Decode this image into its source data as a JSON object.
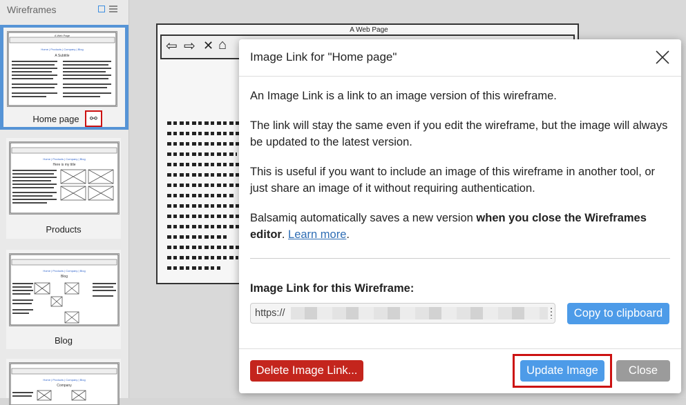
{
  "sidebar": {
    "title": "Wireframes",
    "items": [
      {
        "label": "Home page",
        "selected": true
      },
      {
        "label": "Products",
        "selected": false
      },
      {
        "label": "Blog",
        "selected": false
      },
      {
        "label": "",
        "selected": false
      }
    ],
    "thumbs": [
      {
        "subtitle": "A Subtitle"
      },
      {
        "subtitle": "Here is my title"
      },
      {
        "subtitle": "Blog"
      },
      {
        "subtitle": "Company"
      }
    ],
    "thumb_nav": "Home | Products | Company | Blog",
    "thumb_header": "A Web Page"
  },
  "canvas": {
    "wireframe_title": "A Web Page"
  },
  "dialog": {
    "title": "Image Link for \"Home page\"",
    "p1": "An Image Link is a link to an image version of this wireframe.",
    "p2": "The link will stay the same even if you edit the wireframe, but the image will always be updated to the latest version.",
    "p3": "This is useful if you want to include an image of this wireframe in another tool, or just share an image of it without requiring authentication.",
    "p4_before": "Balsamiq automatically saves a new version ",
    "p4_bold": "when you close the Wireframes editor",
    "p4_after": ". ",
    "learn_more": "Learn more",
    "p4_end": ".",
    "link_label": "Image Link for this Wireframe:",
    "link_value": "https://",
    "copy_label": "Copy to clipboard",
    "delete_label": "Delete Image Link...",
    "update_label": "Update Image",
    "close_label": "Close"
  },
  "colors": {
    "accent": "#4d9be8",
    "danger": "#c4251d",
    "highlight": "#cc1111",
    "selected": "#5694d6"
  }
}
